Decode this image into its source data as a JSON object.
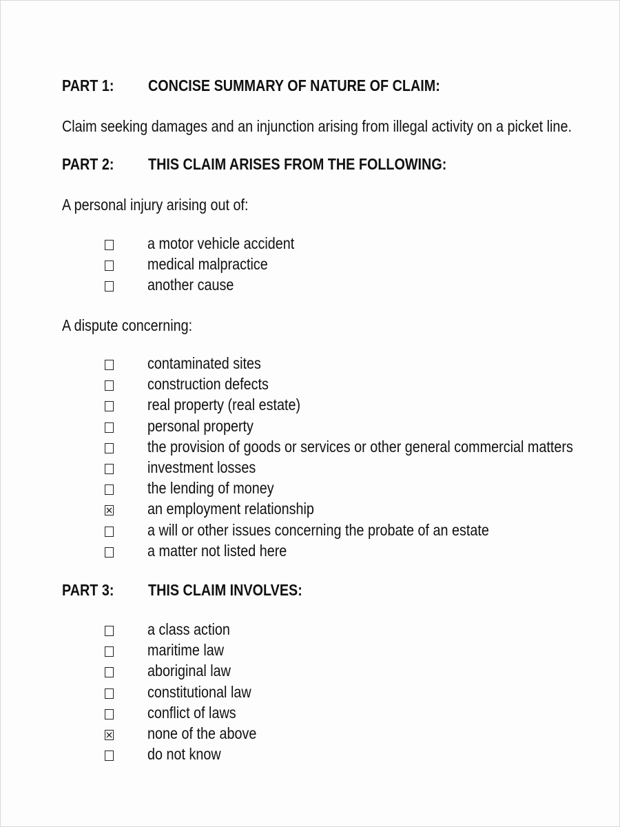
{
  "part1": {
    "number": "PART 1:",
    "title": "CONCISE SUMMARY OF NATURE OF CLAIM:",
    "text": "Claim seeking damages and an injunction arising from illegal activity on a picket line."
  },
  "part2": {
    "number": "PART 2:",
    "title": "THIS CLAIM ARISES FROM THE FOLLOWING:",
    "personal_injury": {
      "heading": "A personal injury arising out of:",
      "options": [
        {
          "label": "a motor vehicle accident",
          "checked": false
        },
        {
          "label": "medical malpractice",
          "checked": false
        },
        {
          "label": "another cause",
          "checked": false
        }
      ]
    },
    "dispute": {
      "heading": "A dispute concerning:",
      "options": [
        {
          "label": "contaminated sites",
          "checked": false
        },
        {
          "label": "construction defects",
          "checked": false
        },
        {
          "label": "real property (real estate)",
          "checked": false
        },
        {
          "label": "personal property",
          "checked": false
        },
        {
          "label": "the provision of goods or services or other general commercial matters",
          "checked": false
        },
        {
          "label": "investment losses",
          "checked": false
        },
        {
          "label": "the lending of money",
          "checked": false
        },
        {
          "label": "an employment relationship",
          "checked": true
        },
        {
          "label": "a will or other issues concerning the probate of an estate",
          "checked": false
        },
        {
          "label": "a matter not listed here",
          "checked": false
        }
      ]
    }
  },
  "part3": {
    "number": "PART 3:",
    "title": "THIS CLAIM INVOLVES:",
    "options": [
      {
        "label": "a class action",
        "checked": false
      },
      {
        "label": "maritime law",
        "checked": false
      },
      {
        "label": "aboriginal law",
        "checked": false
      },
      {
        "label": "constitutional law",
        "checked": false
      },
      {
        "label": "conflict of laws",
        "checked": false
      },
      {
        "label": "none of the above",
        "checked": true
      },
      {
        "label": "do not know",
        "checked": false
      }
    ]
  }
}
